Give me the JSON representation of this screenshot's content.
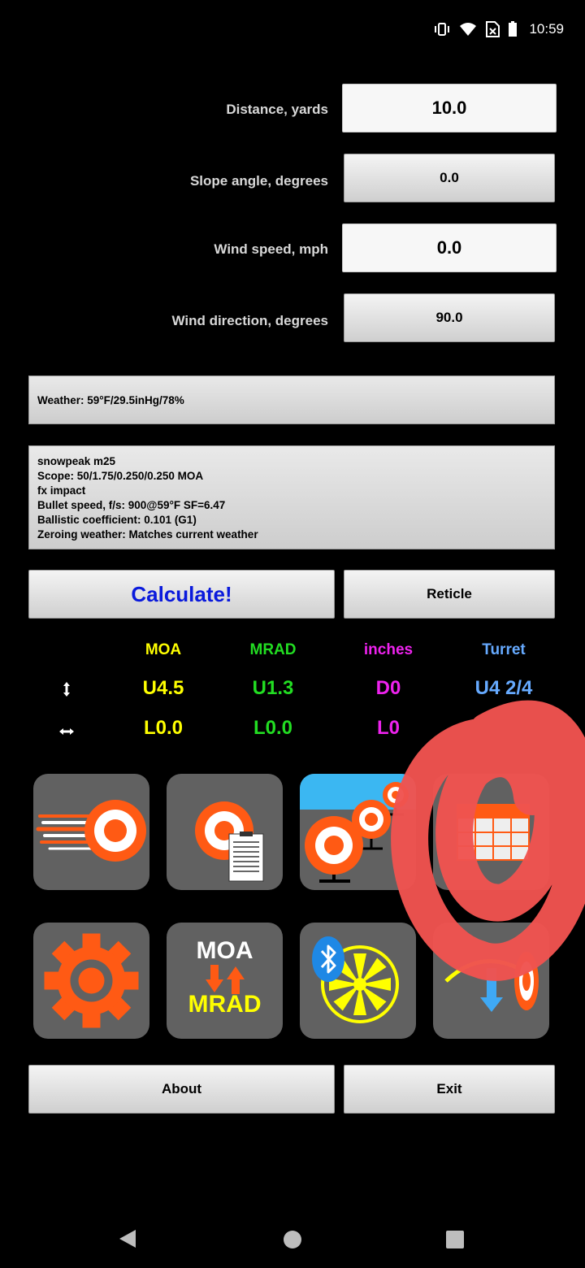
{
  "status_bar": {
    "time": "10:59"
  },
  "inputs": {
    "distance": {
      "label": "Distance, yards",
      "value": "10.0"
    },
    "slope": {
      "label": "Slope angle, degrees",
      "value": "0.0"
    },
    "wind_speed": {
      "label": "Wind speed, mph",
      "value": "0.0"
    },
    "wind_direction": {
      "label": "Wind direction, degrees",
      "value": "90.0"
    }
  },
  "weather": "Weather: 59°F/29.5inHg/78%",
  "profile_lines": [
    "snowpeak m25",
    "Scope: 50/1.75/0.250/0.250 MOA",
    "fx impact",
    "Bullet speed, f/s: 900@59°F SF=6.47",
    "Ballistic coefficient: 0.101 (G1)",
    "Zeroing weather: Matches current weather"
  ],
  "buttons": {
    "calculate": "Calculate!",
    "reticle": "Reticle",
    "about": "About",
    "exit": "Exit"
  },
  "results": {
    "headers": {
      "moa": "MOA",
      "mrad": "MRAD",
      "inches": "inches",
      "turret": "Turret"
    },
    "vertical": {
      "moa": "U4.5",
      "mrad": "U1.3",
      "inches": "D0",
      "turret": "U4 2/4"
    },
    "horizontal": {
      "moa": "L0.0",
      "mrad": "L0.0",
      "inches": "L0"
    }
  },
  "tiles": {
    "moa_text": "MOA",
    "mrad_text": "MRAD"
  },
  "colors": {
    "moa": "#ffff00",
    "mrad": "#22dd22",
    "inches": "#ee22ee",
    "turret": "#66aaff",
    "calculate": "#0a1adc",
    "target_orange": "#ff5a14",
    "annotation_red": "#ef5350"
  }
}
